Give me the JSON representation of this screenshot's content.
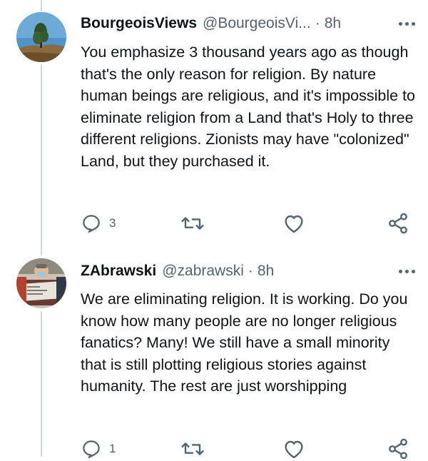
{
  "tweets": [
    {
      "display_name": "BourgeoisViews",
      "handle": "@BourgeoisVi...",
      "separator": "·",
      "time": "8h",
      "text": "You emphasize 3 thousand years ago as though that's the only reason for religion. By nature human beings are religious, and it's impossible to eliminate religion from a Land that's Holy to three different religions. Zionists may have \"colonized\" Land, but they purchased it.",
      "reply_count": "3"
    },
    {
      "display_name": "ZAbrawski",
      "handle": "@zabrawski",
      "separator": "·",
      "time": "8h",
      "text": "We are eliminating religion. It is working. Do you know how many people are no longer religious fanatics? Many! We still have a small minority that is still plotting religious stories against humanity. The rest are just worshipping",
      "reply_count": "1"
    }
  ],
  "icons": {
    "reply": "reply-icon",
    "retweet": "retweet-icon",
    "like": "like-icon",
    "share": "share-icon",
    "more": "more-icon"
  },
  "colors": {
    "icon": "#536471",
    "thread_line": "#cfd9de"
  }
}
